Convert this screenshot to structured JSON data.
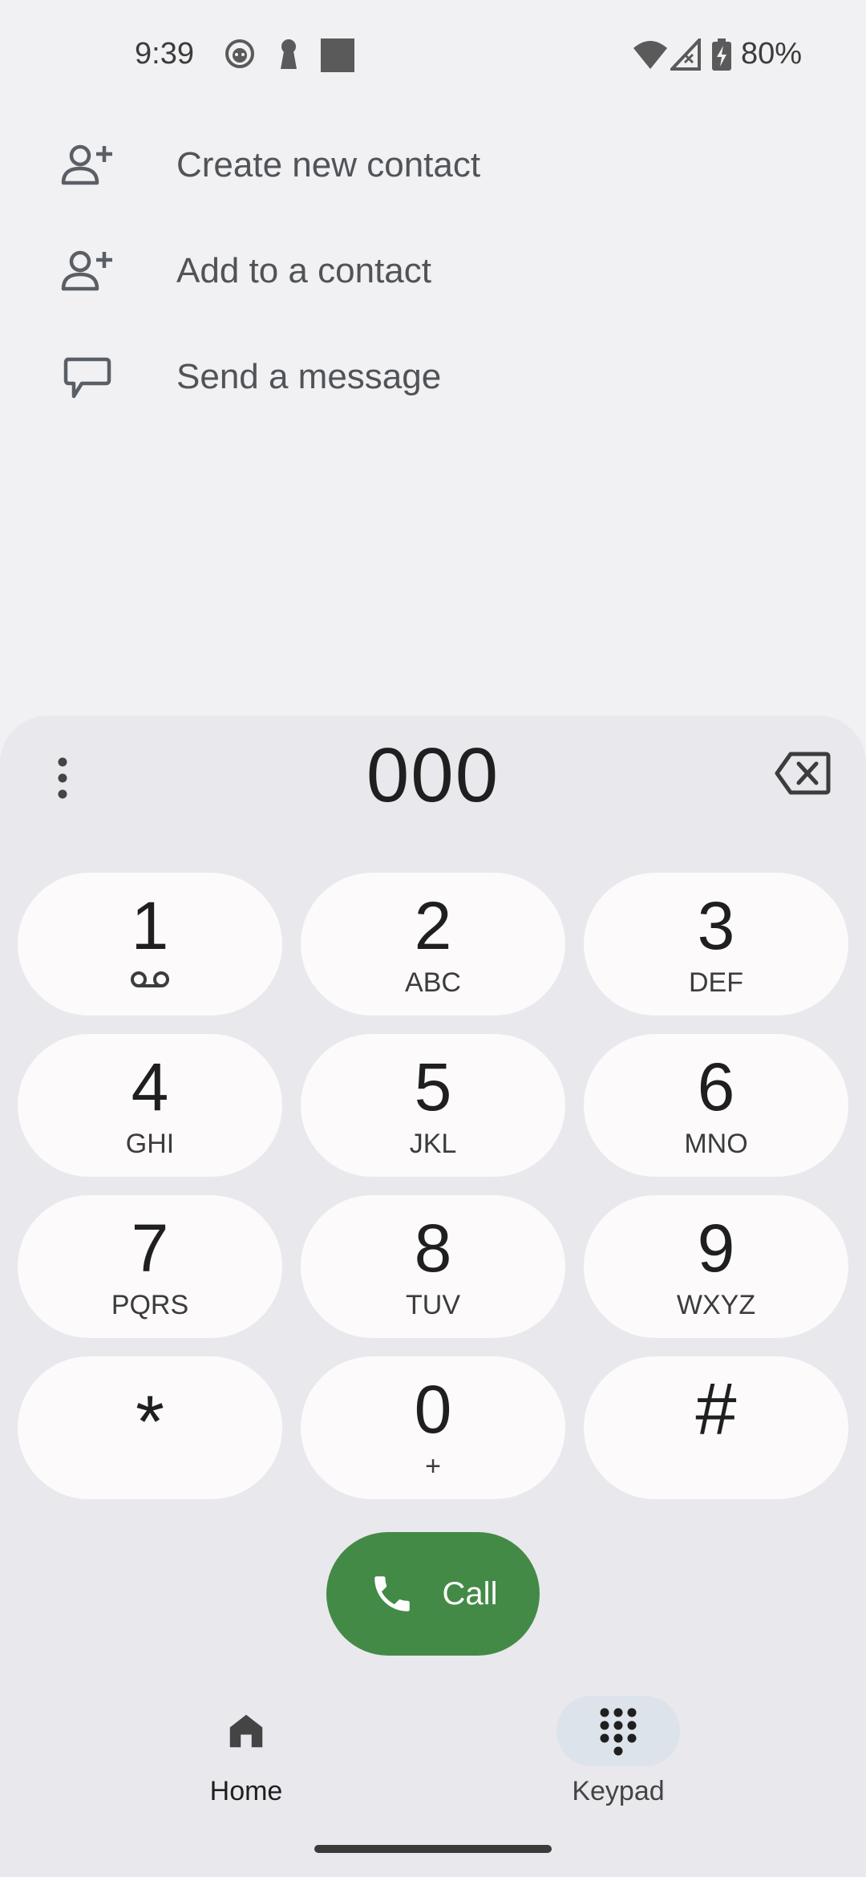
{
  "status_bar": {
    "time": "9:39",
    "battery": "80%",
    "icons": [
      "face-icon",
      "keyhole-icon",
      "square-icon",
      "wifi-icon",
      "signal-icon",
      "battery-charging-icon"
    ]
  },
  "actions": {
    "create_contact": "Create new contact",
    "add_to_contact": "Add to a contact",
    "send_message": "Send a message"
  },
  "dialer": {
    "number": "000",
    "keys": [
      {
        "digit": "1",
        "letters": ""
      },
      {
        "digit": "2",
        "letters": "ABC"
      },
      {
        "digit": "3",
        "letters": "DEF"
      },
      {
        "digit": "4",
        "letters": "GHI"
      },
      {
        "digit": "5",
        "letters": "JKL"
      },
      {
        "digit": "6",
        "letters": "MNO"
      },
      {
        "digit": "7",
        "letters": "PQRS"
      },
      {
        "digit": "8",
        "letters": "TUV"
      },
      {
        "digit": "9",
        "letters": "WXYZ"
      },
      {
        "digit": "*",
        "letters": ""
      },
      {
        "digit": "0",
        "letters": "+"
      },
      {
        "digit": "#",
        "letters": ""
      }
    ],
    "call_label": "Call"
  },
  "nav": {
    "home": "Home",
    "keypad": "Keypad"
  },
  "colors": {
    "call_green": "#448a47",
    "key_bg": "#fcfafb",
    "panel_bg": "#e9e8ec",
    "nav_active": "#dde3ea"
  }
}
